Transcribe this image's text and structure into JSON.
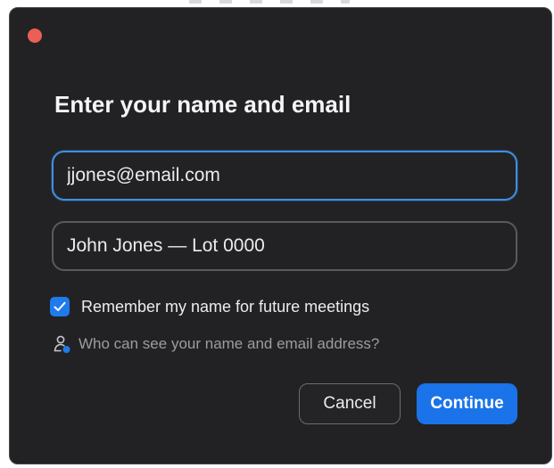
{
  "dialog": {
    "title": "Enter your name and email",
    "close_color": "#ec5f57",
    "email_value": "jjones@email.com",
    "name_value": "John Jones — Lot 0000",
    "remember": {
      "checked": true,
      "label": "Remember my name for future meetings",
      "icon": "checkmark-icon"
    },
    "privacy": {
      "icon": "person-info-icon",
      "label": "Who can see your name and email address?"
    },
    "buttons": {
      "cancel": "Cancel",
      "continue": "Continue"
    },
    "colors": {
      "background": "#222224",
      "accent": "#1a73e8",
      "focus_border": "#3f8fe3",
      "text": "#ececee",
      "muted_text": "#9c9ca1"
    }
  }
}
